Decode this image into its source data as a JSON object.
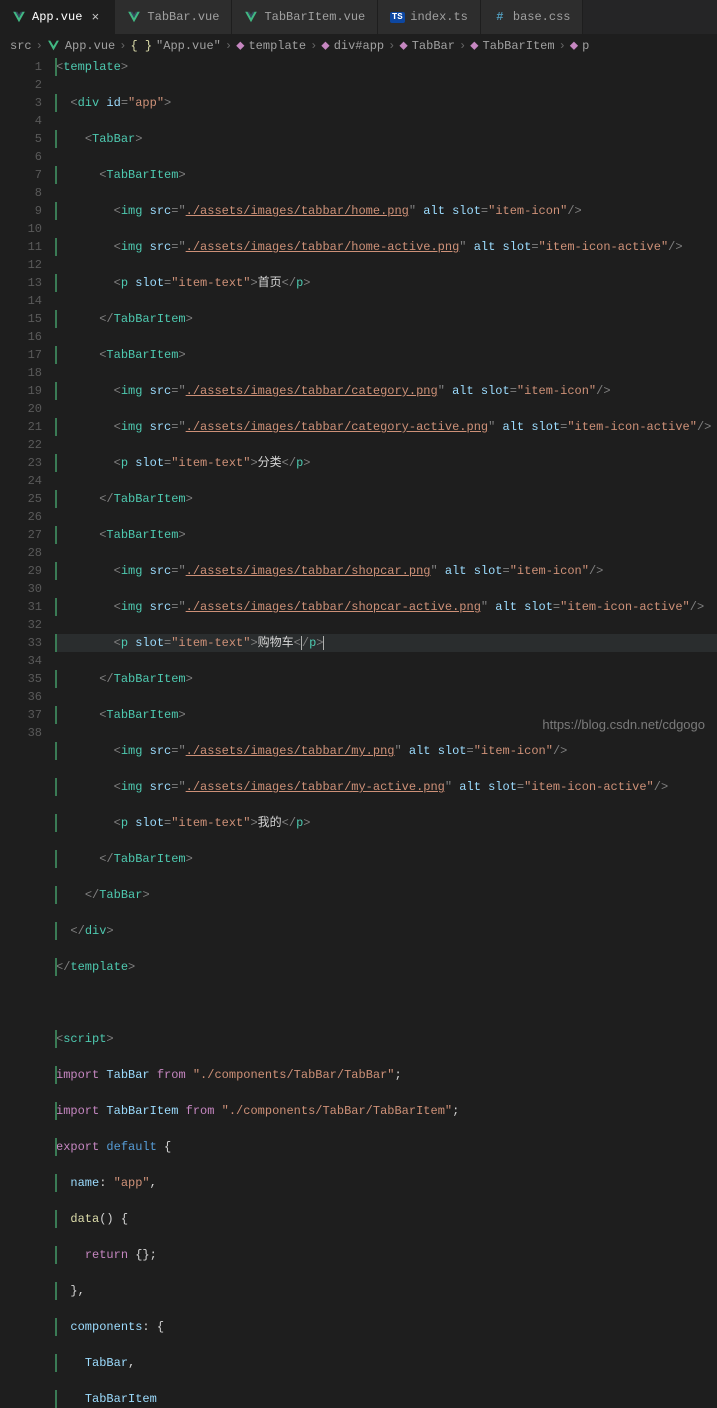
{
  "tabs": [
    {
      "label": "App.vue",
      "icon": "vue",
      "active": true,
      "close": true
    },
    {
      "label": "TabBar.vue",
      "icon": "vue",
      "active": false,
      "close": false
    },
    {
      "label": "TabBarItem.vue",
      "icon": "vue",
      "active": false,
      "close": false
    },
    {
      "label": "index.ts",
      "icon": "ts",
      "active": false,
      "close": false
    },
    {
      "label": "base.css",
      "icon": "hash",
      "active": false,
      "close": false
    }
  ],
  "breadcrumb": {
    "items": [
      {
        "label": "src",
        "icon": null
      },
      {
        "label": "App.vue",
        "icon": "vue"
      },
      {
        "label": "\"App.vue\"",
        "icon": "braces"
      },
      {
        "label": "template",
        "icon": "chevtag"
      },
      {
        "label": "div#app",
        "icon": "chevtag"
      },
      {
        "label": "TabBar",
        "icon": "chevtag"
      },
      {
        "label": "TabBarItem",
        "icon": "chevtag"
      },
      {
        "label": "p",
        "icon": "chevtag"
      }
    ]
  },
  "watermark": "https://blog.csdn.net/cdgogo",
  "code": {
    "line_start": 1,
    "line_end": 38,
    "caret_line": 17,
    "items": [
      {
        "text_label": "首页",
        "icon": "./assets/images/tabbar/home.png",
        "icon_active": "./assets/images/tabbar/home-active.png"
      },
      {
        "text_label": "分类",
        "icon": "./assets/images/tabbar/category.png",
        "icon_active": "./assets/images/tabbar/category-active.png"
      },
      {
        "text_label": "购物车",
        "icon": "./assets/images/tabbar/shopcar.png",
        "icon_active": "./assets/images/tabbar/shopcar-active.png"
      },
      {
        "text_label": "我的",
        "icon": "./assets/images/tabbar/my.png",
        "icon_active": "./assets/images/tabbar/my-active.png"
      }
    ],
    "imports": {
      "TabBar": "./components/TabBar/TabBar",
      "TabBarItem": "./components/TabBar/TabBarItem"
    },
    "app_name": "app"
  }
}
